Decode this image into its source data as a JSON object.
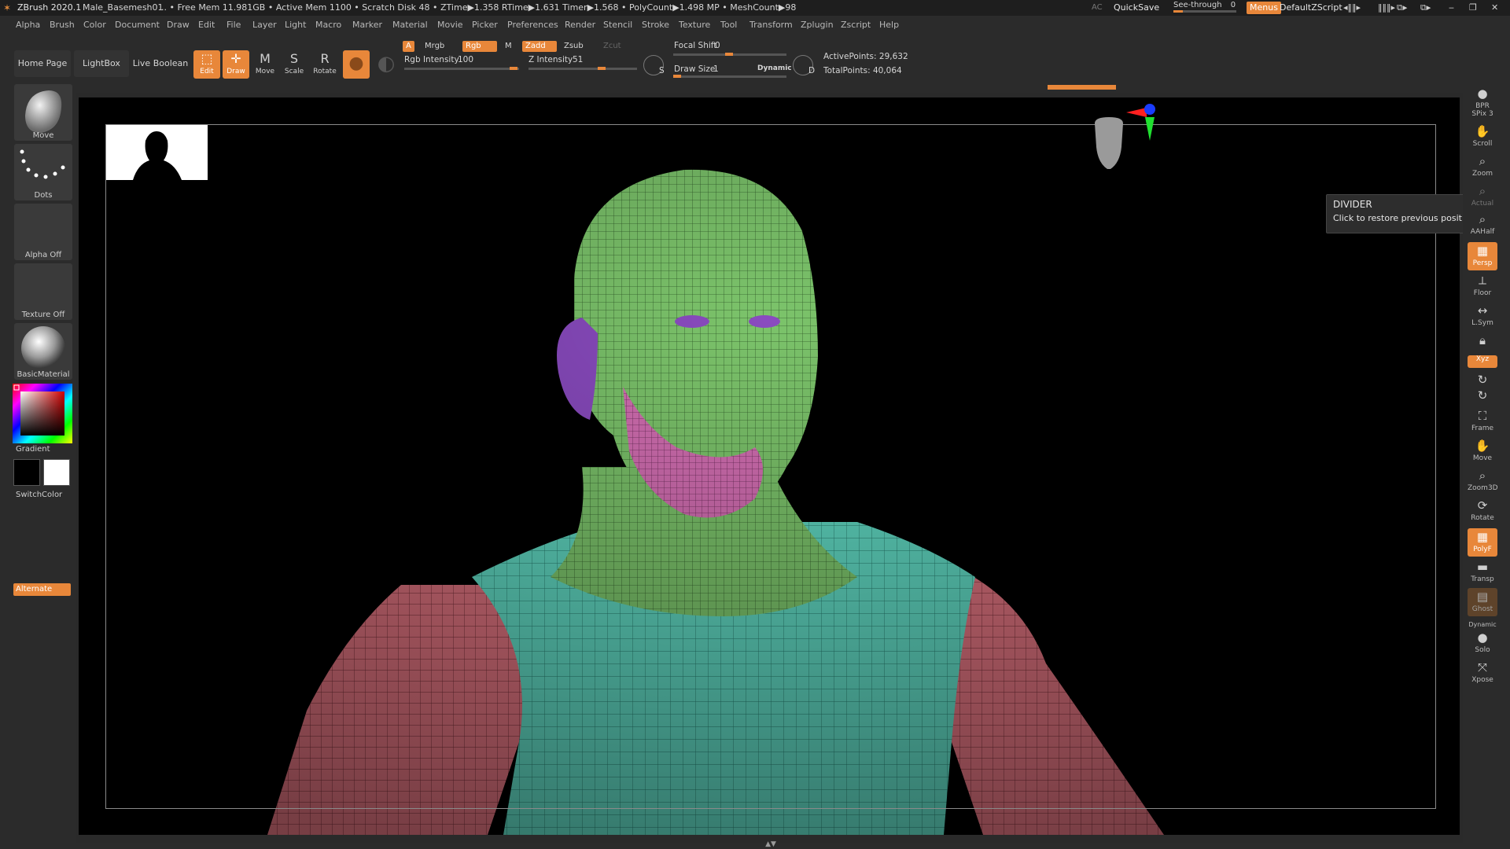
{
  "titlebar": {
    "app": "ZBrush 2020.1",
    "file": "Male_Basemesh01",
    "stats": ".. • Free Mem 11.981GB • Active Mem 1100 • Scratch Disk 48 • ZTime▶1.358 RTime▶1.631 Timer▶1.568 • PolyCount▶1.498 MP • MeshCount▶98",
    "ac": "AC",
    "quicksave": "QuickSave",
    "see_through_label": "See-through",
    "see_through_value": "0",
    "see_through_fraction": 0.0,
    "menus": "Menus",
    "default_zscript": "DefaultZScript"
  },
  "menubar": [
    "Alpha",
    "Brush",
    "Color",
    "Document",
    "Draw",
    "Edit",
    "File",
    "Layer",
    "Light",
    "Macro",
    "Marker",
    "Material",
    "Movie",
    "Picker",
    "Preferences",
    "Render",
    "Stencil",
    "Stroke",
    "Texture",
    "Tool",
    "Transform",
    "Zplugin",
    "Zscript",
    "Help"
  ],
  "toolbar": {
    "home_page": "Home Page",
    "lightbox": "LightBox",
    "live_boolean": "Live Boolean",
    "edit": "Edit",
    "draw": "Draw",
    "move": "Move",
    "scale": "Scale",
    "rotate": "Rotate",
    "a_chip": "A",
    "mrgb": "Mrgb",
    "rgb": "Rgb",
    "m": "M",
    "zadd": "Zadd",
    "zsub": "Zsub",
    "zcut": "Zcut",
    "rgb_intensity_label": "Rgb Intensity",
    "rgb_intensity_value": "100",
    "z_intensity_label": "Z Intensity",
    "z_intensity_value": "51",
    "focal_shift_label": "Focal Shift",
    "focal_shift_value": "0",
    "draw_size_label": "Draw Size",
    "draw_size_value": "1",
    "dynamic": "Dynamic",
    "s_label": "S",
    "d_label": "D",
    "active_points": "ActivePoints: 29,632",
    "total_points": "TotalPoints: 40,064"
  },
  "leftshelf": {
    "brush": "Move",
    "stroke": "Dots",
    "alpha": "Alpha Off",
    "texture": "Texture Off",
    "material": "BasicMaterial",
    "gradient": "Gradient",
    "switch_color": "SwitchColor",
    "alternate": "Alternate"
  },
  "rightshelf": [
    {
      "label": "BPR",
      "icon": "bpr-icon"
    },
    {
      "label": "SPix 3",
      "icon": "spix-icon"
    },
    {
      "label": "Scroll",
      "icon": "scroll-icon"
    },
    {
      "label": "Zoom",
      "icon": "zoom-icon"
    },
    {
      "label": "Actual",
      "icon": "actual-icon"
    },
    {
      "label": "AAHalf",
      "icon": "aahalf-icon"
    },
    {
      "label": "Persp",
      "icon": "persp-icon"
    },
    {
      "label": "Floor",
      "icon": "floor-icon"
    },
    {
      "label": "L.Sym",
      "icon": "lsym-icon"
    },
    {
      "label": "Lock",
      "icon": "lock-icon"
    },
    {
      "label": "Xyz",
      "icon": "xyz-icon"
    },
    {
      "label": "",
      "icon": "rotate-axis-icon"
    },
    {
      "label": "",
      "icon": "rotate-axis2-icon"
    },
    {
      "label": "Frame",
      "icon": "frame-icon"
    },
    {
      "label": "Move",
      "icon": "move-icon"
    },
    {
      "label": "Zoom3D",
      "icon": "zoom3d-icon"
    },
    {
      "label": "Rotate",
      "icon": "rotate-icon"
    },
    {
      "label": "PolyF",
      "icon": "polyf-icon"
    },
    {
      "label": "Transp",
      "icon": "transp-icon"
    },
    {
      "label": "Ghost",
      "icon": "ghost-icon"
    },
    {
      "label": "Dynamic",
      "icon": "dynamic-icon"
    },
    {
      "label": "Solo",
      "icon": "solo-icon"
    },
    {
      "label": "Xpose",
      "icon": "xpose-icon"
    }
  ],
  "tooltip": {
    "title": "DIVIDER",
    "text": "Click to restore previous position."
  },
  "colors": {
    "accent": "#e8873a",
    "background": "#2b2b2b",
    "canvas": "#000000",
    "mesh_green": "#7cc46b",
    "mesh_teal": "#5fd6c0",
    "mesh_pink": "#d9707c",
    "mesh_magenta": "#c65aa6",
    "mesh_purple": "#8a4bc0"
  }
}
